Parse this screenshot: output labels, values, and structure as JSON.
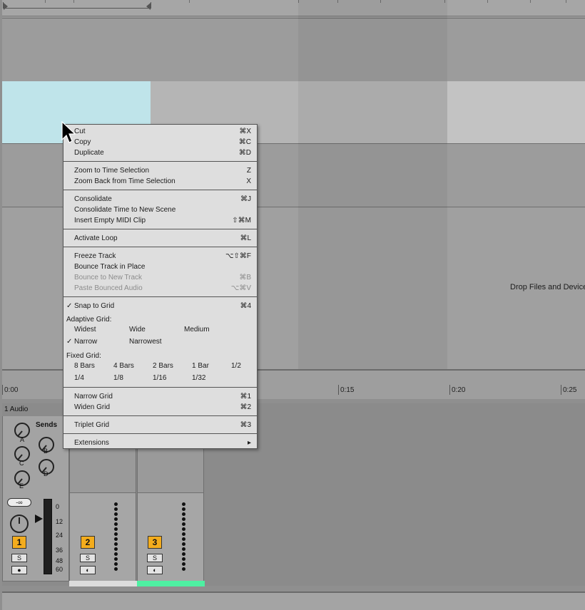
{
  "arrangement": {
    "drop_hint": "Drop Files and Device",
    "time_ruler": [
      "0:00",
      "0:15",
      "0:20",
      "0:25"
    ]
  },
  "mixer": {
    "track1": {
      "title": "1 Audio",
      "sends_label": "Sends",
      "send_knobs": [
        "A",
        "B",
        "C",
        "D",
        "E"
      ],
      "volume_display": "-∞",
      "db_scale": [
        "0",
        "12",
        "24",
        "36",
        "48",
        "60"
      ],
      "number": "1",
      "solo": "S"
    },
    "track2": {
      "number": "2",
      "solo": "S"
    },
    "track3": {
      "number": "3",
      "solo": "S"
    }
  },
  "context_menu": {
    "items": [
      {
        "label": "Cut",
        "shortcut": "⌘X"
      },
      {
        "label": "Copy",
        "shortcut": "⌘C"
      },
      {
        "label": "Duplicate",
        "shortcut": "⌘D"
      },
      {
        "label": "Zoom to Time Selection",
        "shortcut": "Z"
      },
      {
        "label": "Zoom Back from Time Selection",
        "shortcut": "X"
      },
      {
        "label": "Consolidate",
        "shortcut": "⌘J"
      },
      {
        "label": "Consolidate Time to New Scene",
        "shortcut": ""
      },
      {
        "label": "Insert Empty MIDI Clip",
        "shortcut": "⇧⌘M"
      },
      {
        "label": "Activate Loop",
        "shortcut": "⌘L"
      },
      {
        "label": "Freeze Track",
        "shortcut": "⌥⇧⌘F"
      },
      {
        "label": "Bounce Track in Place",
        "shortcut": ""
      },
      {
        "label": "Bounce to New Track",
        "shortcut": "⌘B"
      },
      {
        "label": "Paste Bounced Audio",
        "shortcut": "⌥⌘V"
      },
      {
        "label": "Snap to Grid",
        "shortcut": "⌘4"
      },
      {
        "label": "Narrow Grid",
        "shortcut": "⌘1"
      },
      {
        "label": "Widen Grid",
        "shortcut": "⌘2"
      },
      {
        "label": "Triplet Grid",
        "shortcut": "⌘3"
      },
      {
        "label": "Extensions",
        "shortcut": "▸"
      }
    ],
    "adaptive_grid": {
      "heading": "Adaptive Grid:",
      "options": [
        "Widest",
        "Wide",
        "Medium",
        "Narrow",
        "Narrowest"
      ],
      "selected": "Narrow"
    },
    "fixed_grid": {
      "heading": "Fixed Grid:",
      "options": [
        "8 Bars",
        "4 Bars",
        "2 Bars",
        "1 Bar",
        "1/2",
        "1/4",
        "1/8",
        "1/16",
        "1/32"
      ]
    },
    "check_mark": "✓"
  },
  "colors": {
    "selected_clip": "#bfe4ea",
    "track_number": "#f3ac1d",
    "track3_stripe": "#4ef0a2"
  },
  "icons": [
    "mouse-pointer-icon",
    "play-triangle-icon",
    "submenu-arrow-icon",
    "checkmark-icon"
  ]
}
